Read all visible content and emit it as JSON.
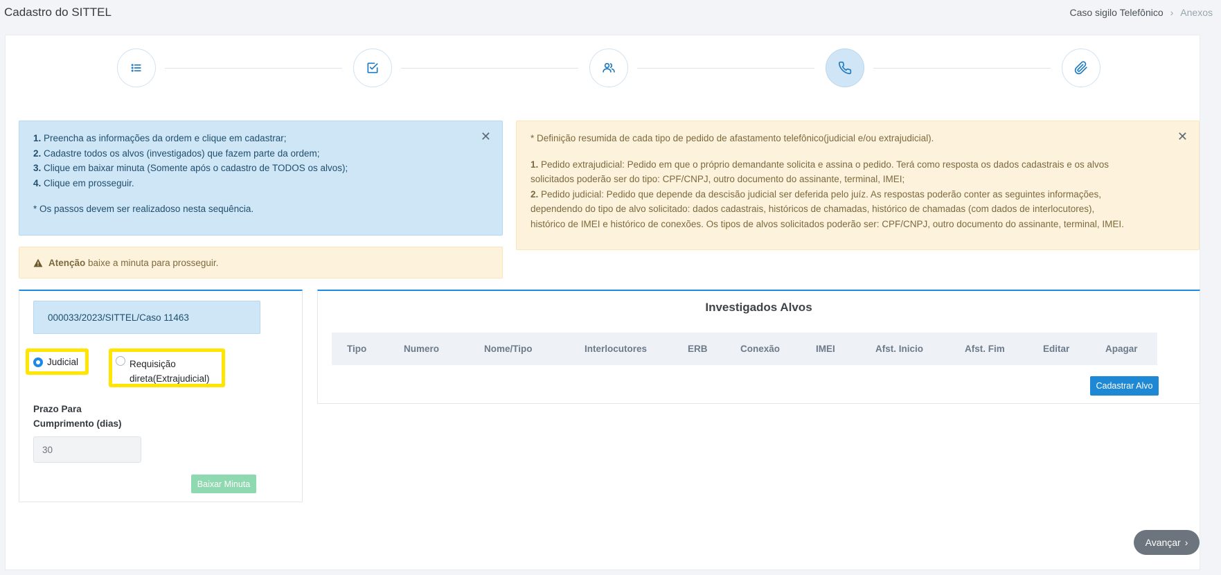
{
  "header": {
    "title": "Cadastro do SITTEL",
    "breadcrumb": [
      "Caso sigilo Telefônico",
      "Anexos"
    ]
  },
  "wizard": {
    "steps": [
      {
        "icon": "list-icon"
      },
      {
        "icon": "checkbox-icon"
      },
      {
        "icon": "users-icon"
      },
      {
        "icon": "phone-icon",
        "active": true
      },
      {
        "icon": "paperclip-icon"
      }
    ]
  },
  "info_alert": {
    "steps": [
      {
        "num": "1.",
        "text": " Preencha as informações da ordem e clique em cadastrar;"
      },
      {
        "num": "2.",
        "text": " Cadastre todos os alvos (investigados) que fazem parte da ordem;"
      },
      {
        "num": "3.",
        "text": " Clique em baixar minuta (Somente após o cadastro de TODOS os alvos);"
      },
      {
        "num": "4.",
        "text": " Clique em prosseguir."
      }
    ],
    "note": "* Os passos devem ser realizadoso nesta sequência."
  },
  "definition_alert": {
    "intro": "* Definição resumida de cada tipo de pedido de afastamento telefônico(judicial e/ou extrajudicial).",
    "item1_num": "1.",
    "item1_line1": " Pedido extrajudicial: Pedido em que o próprio demandante solicita e assina o pedido. Terá como resposta os dados cadastrais e os alvos",
    "item1_line2": "solicitados poderão ser do tipo: CPF/CNPJ, outro documento do assinante, terminal, IMEI;",
    "item2_num": "2.",
    "item2_line1": " Pedido judicial: Pedido que depende da descisão judicial ser deferida pelo juíz. As respostas poderão conter as seguintes informações,",
    "item2_line2": "dependendo do tipo de alvo solicitado: dados cadastrais, históricos de chamadas, histórico de chamadas (com dados de interlocutores),",
    "item2_line3": "histórico de IMEI e histórico de conexões. Os tipos de alvos solicitados poderão ser: CPF/CNPJ, outro documento do assinante, terminal, IMEI."
  },
  "attention_alert": {
    "bold": "Atenção",
    "text": " baixe a minuta para prosseguir."
  },
  "order": {
    "case_id": "000033/2023/SITTEL/Caso 11463",
    "radio_judicial": "Judicial",
    "radio_extra_line1": "Requisição",
    "radio_extra_line2": "direta(Extrajudicial)",
    "selected": "Judicial",
    "prazo_line1": "Prazo Para",
    "prazo_line2": "Cumprimento (dias)",
    "prazo_value": "30",
    "baixar_label": "Baixar Minuta"
  },
  "targets": {
    "title": "Investigados Alvos",
    "columns": [
      "Tipo",
      "Numero",
      "Nome/Tipo",
      "Interlocutores",
      "ERB",
      "Conexão",
      "IMEI",
      "Afst. Inicio",
      "Afst. Fim",
      "Editar",
      "Apagar"
    ],
    "add_label": "Cadastrar Alvo"
  },
  "footer": {
    "next_label": "Avançar"
  }
}
